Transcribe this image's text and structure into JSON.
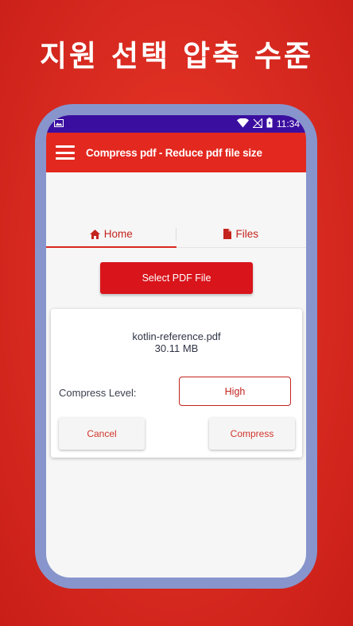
{
  "promo": {
    "title": "지원 선택 압축 수준"
  },
  "status_bar": {
    "time": "11:34",
    "icons": [
      "image-icon",
      "wifi-icon",
      "no-signal-icon",
      "battery-icon"
    ]
  },
  "app_bar": {
    "title": "Compress pdf - Reduce pdf file size",
    "menu_icon": "hamburger-menu-icon"
  },
  "tabs": [
    {
      "label": "Home",
      "icon": "home-icon",
      "active": true
    },
    {
      "label": "Files",
      "icon": "file-icon",
      "active": false
    }
  ],
  "select_button": {
    "label": "Select PDF File"
  },
  "file_card": {
    "file_name": "kotlin-reference.pdf",
    "file_size": "30.11 MB",
    "compress_level_label": "Compress Level:",
    "compress_level_value": "High",
    "cancel_label": "Cancel",
    "compress_label": "Compress"
  },
  "colors": {
    "accent": "#e3281f",
    "status_bar": "#3a0fa0",
    "phone_frame": "#8795cc"
  }
}
